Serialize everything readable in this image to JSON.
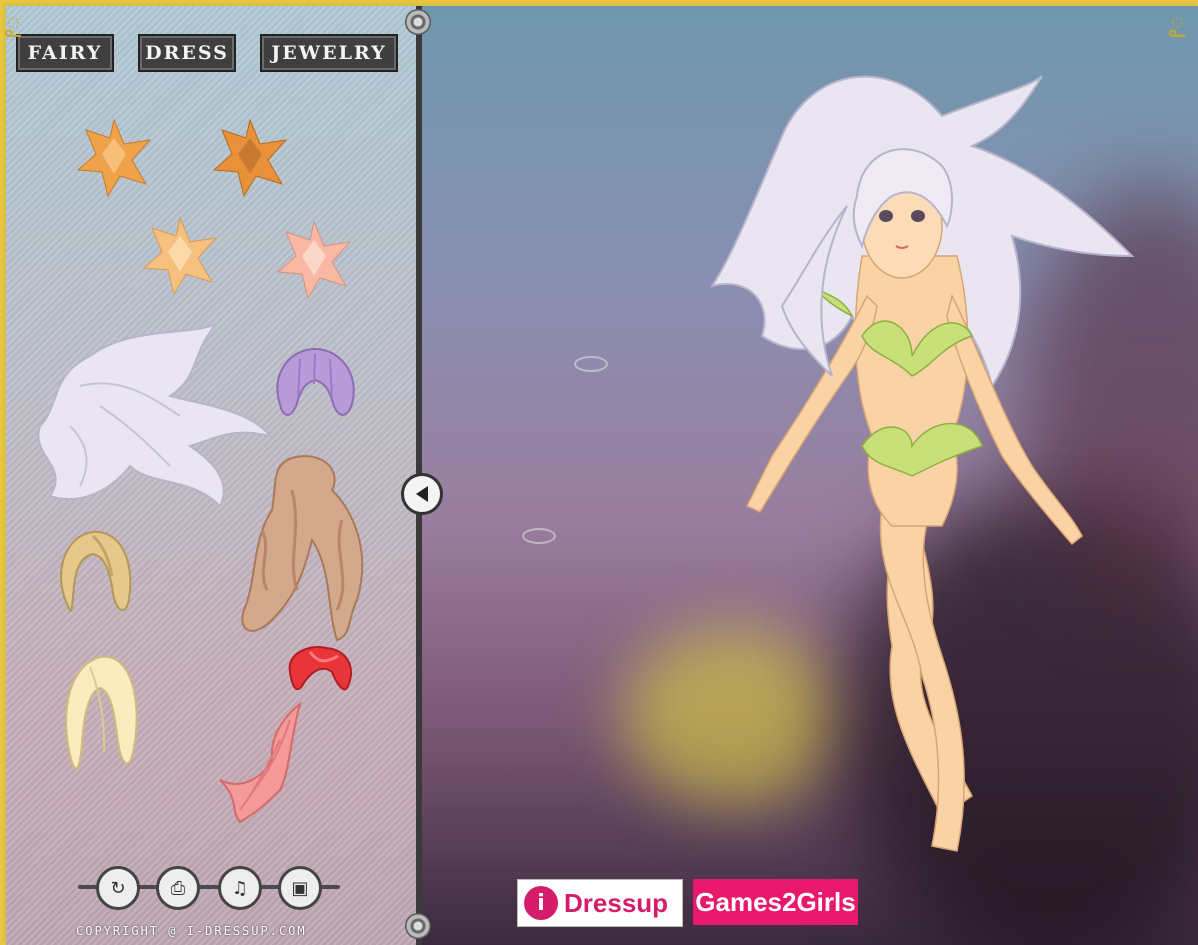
{
  "tabs": [
    {
      "label": "FAIRY"
    },
    {
      "label": "DRESS"
    },
    {
      "label": "JEWELRY"
    }
  ],
  "toolbar": {
    "buttons": [
      "reset-icon",
      "print-icon",
      "music-icon",
      "save-image-icon"
    ]
  },
  "copyright": "COPYRIGHT @ I-DRESSUP.COM",
  "logos": {
    "idressup": "Dressup",
    "idressup_badge": "i",
    "games2girls": "Games2Girls"
  },
  "colors": {
    "accent_gold": "#e8c83a",
    "tab_bg": "#3f3f3f",
    "games2girls_pink": "#e8196d",
    "hair_silver": "#e6e3ef",
    "skin": "#f9d3a6",
    "leaf_green": "#c9e07a"
  },
  "items": {
    "accessories": [
      "star-orange-1",
      "star-orange-2",
      "star-peach",
      "star-pink"
    ],
    "hair": [
      "hair-silver-long",
      "hair-lilac-short",
      "hair-brown-wavy",
      "hair-blonde-short",
      "hair-blonde-bob",
      "hair-red-long"
    ]
  }
}
